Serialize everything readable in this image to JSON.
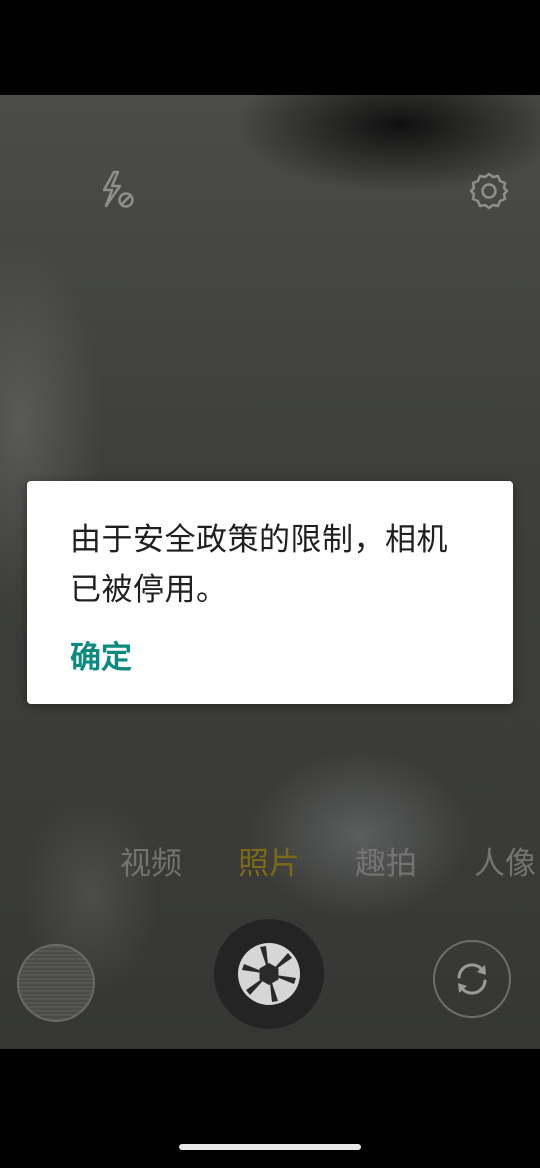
{
  "dialog": {
    "message": "由于安全政策的限制，相机已被停用。",
    "ok_label": "确定"
  },
  "modes": [
    {
      "label": "视频",
      "active": false
    },
    {
      "label": "照片",
      "active": true
    },
    {
      "label": "趣拍",
      "active": false
    },
    {
      "label": "人像",
      "active": false
    }
  ],
  "icons": {
    "flash": "flash-off-icon",
    "settings": "gear-icon",
    "shutter": "aperture-icon",
    "switch": "switch-camera-icon"
  },
  "colors": {
    "accent": "#0b8a7f",
    "active_mode": "#7d6a16",
    "inactive_mode": "#737371"
  }
}
